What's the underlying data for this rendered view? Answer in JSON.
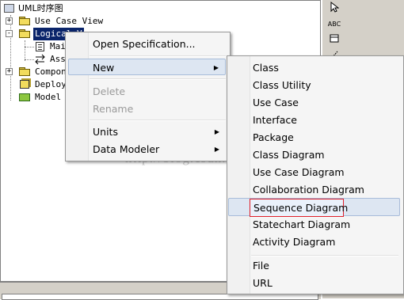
{
  "tree": {
    "root": {
      "label": "UML时序图"
    },
    "items": [
      {
        "label": "Use Case View",
        "expander": "+"
      },
      {
        "label": "Logical V",
        "expander": "-"
      },
      {
        "label": "Mai"
      },
      {
        "label": "Ass"
      },
      {
        "label": "Compon",
        "expander": "+"
      },
      {
        "label": "Deploy"
      },
      {
        "label": "Model I"
      }
    ]
  },
  "toolbar": {
    "abc": "ABC"
  },
  "context_menu": {
    "items": [
      {
        "label": "Open Specification..."
      },
      {
        "label": "New",
        "arrow": "▶"
      },
      {
        "label": "Delete"
      },
      {
        "label": "Rename"
      },
      {
        "label": "Units",
        "arrow": "▶"
      },
      {
        "label": "Data Modeler",
        "arrow": "▶"
      }
    ]
  },
  "submenu": {
    "items": [
      {
        "label": "Class"
      },
      {
        "label": "Class Utility"
      },
      {
        "label": "Use Case"
      },
      {
        "label": "Interface"
      },
      {
        "label": "Package"
      },
      {
        "label": "Class Diagram"
      },
      {
        "label": "Use Case Diagram"
      },
      {
        "label": "Collaboration Diagram"
      },
      {
        "label": "Sequence Diagram"
      },
      {
        "label": "Statechart Diagram"
      },
      {
        "label": "Activity Diagram"
      },
      {
        "label": "File"
      },
      {
        "label": "URL"
      }
    ]
  },
  "watermark": "http://blog.csdn.net/"
}
